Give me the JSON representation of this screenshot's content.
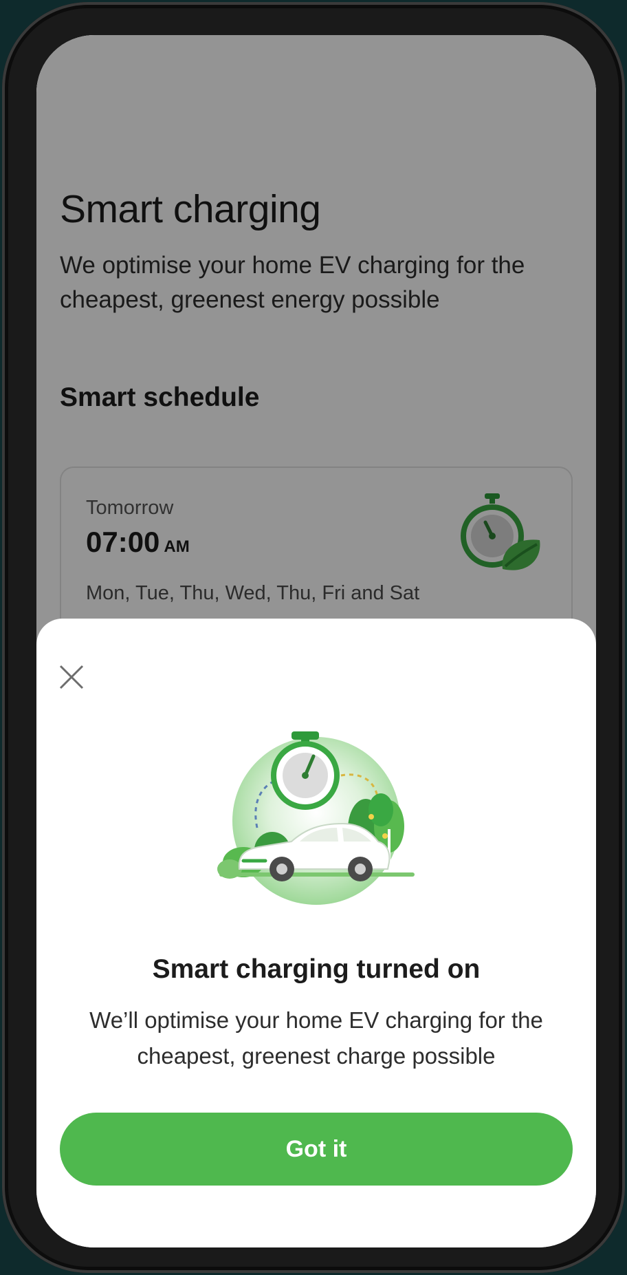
{
  "screen": {
    "title": "Smart charging",
    "subtitle": "We optimise your home EV charging for the cheapest, greenest energy possible",
    "section_title": "Smart schedule",
    "schedule_card": {
      "day": "Tomorrow",
      "time": "07:00",
      "ampm": "AM",
      "days": "Mon, Tue, Thu, Wed, Thu, Fri and Sat",
      "icon": "stopwatch-leaf-icon"
    }
  },
  "modal": {
    "close_icon": "close-icon",
    "illustration": "ev-car-stopwatch-illustration",
    "title": "Smart charging turned on",
    "body": "We’ll optimise your home EV charging for the cheapest, greenest charge possible",
    "button_label": "Got it"
  },
  "colors": {
    "accent": "#4fb84e",
    "overlay": "rgba(0,0,0,0.42)",
    "device_background": "#0e2a2c"
  }
}
